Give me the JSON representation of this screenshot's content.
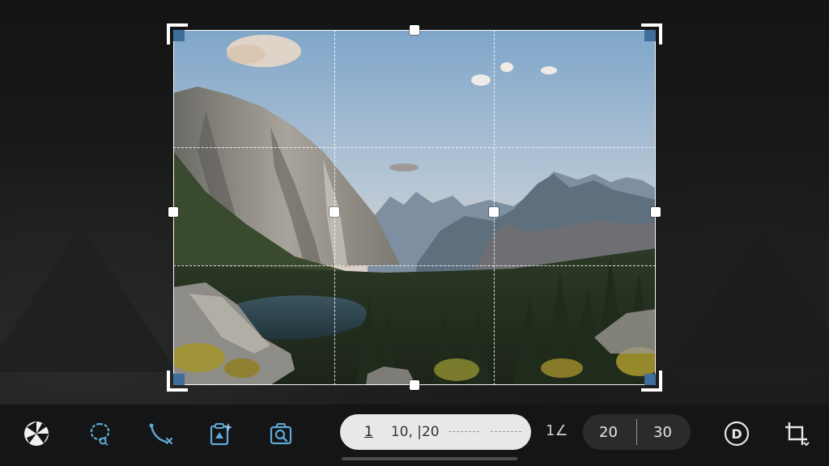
{
  "crop_tool": {
    "grid": "rule-of-thirds",
    "accent_color": "#3e6e99"
  },
  "toolbar": {
    "tools": [
      {
        "name": "aperture-icon",
        "color": "#ffffff"
      },
      {
        "name": "lasso-icon",
        "color": "#5fa8d3"
      },
      {
        "name": "path-cut-icon",
        "color": "#5fa8d3"
      },
      {
        "name": "clipboard-sparkle-icon",
        "color": "#5fa8d3"
      },
      {
        "name": "image-search-icon",
        "color": "#5fa8d3"
      }
    ],
    "position_pill": {
      "index": "1",
      "value": "10, |20"
    },
    "ratio_label": "1∠",
    "dimensions": {
      "width": "20",
      "height": "30"
    },
    "right_tools": [
      {
        "name": "d-circle-icon"
      },
      {
        "name": "crop-rotate-icon"
      }
    ]
  }
}
